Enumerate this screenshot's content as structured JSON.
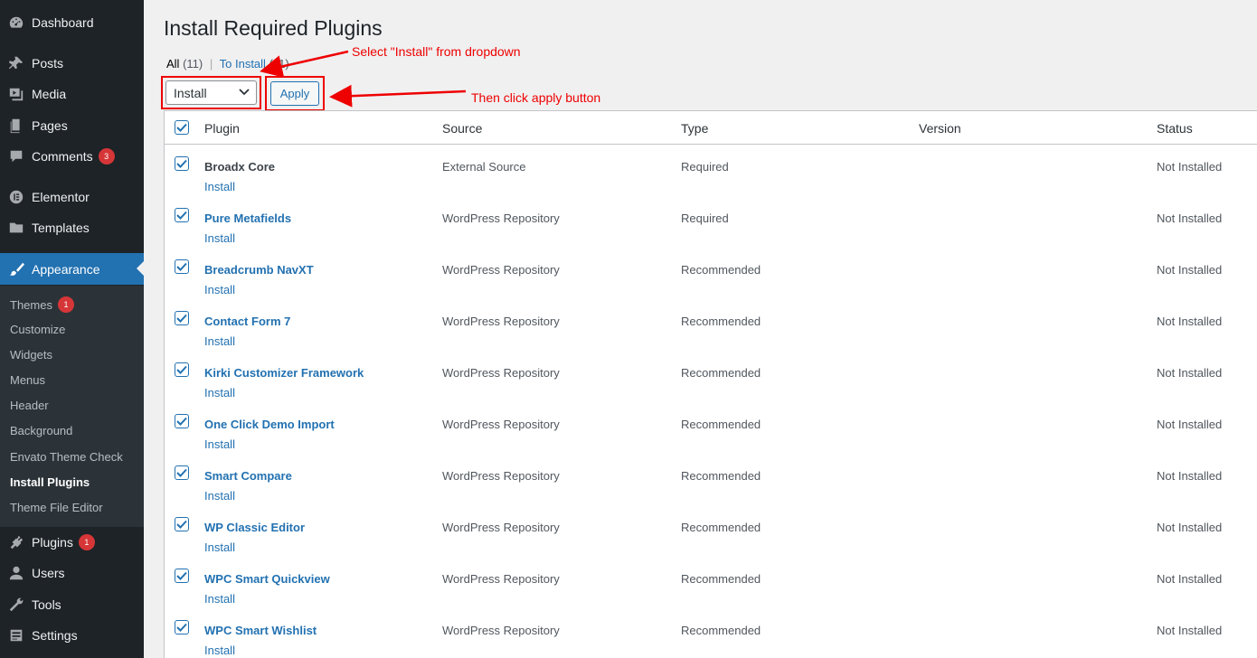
{
  "sidebar": {
    "dashboard": "Dashboard",
    "posts": "Posts",
    "media": "Media",
    "pages": "Pages",
    "comments": "Comments",
    "comments_badge": "3",
    "elementor": "Elementor",
    "templates": "Templates",
    "appearance": "Appearance",
    "plugins": "Plugins",
    "plugins_badge": "1",
    "users": "Users",
    "tools": "Tools",
    "settings": "Settings",
    "submenu": {
      "themes": "Themes",
      "themes_badge": "1",
      "customize": "Customize",
      "widgets": "Widgets",
      "menus": "Menus",
      "header": "Header",
      "background": "Background",
      "envato": "Envato Theme Check",
      "install_plugins": "Install Plugins",
      "theme_file_editor": "Theme File Editor"
    }
  },
  "page": {
    "title": "Install Required Plugins",
    "filter_all": "All",
    "filter_all_count": "(11)",
    "separator": "|",
    "filter_to_install": "To Install",
    "filter_to_install_count": "(11)",
    "bulk_action_selected": "Install",
    "apply_label": "Apply"
  },
  "annotations": {
    "select_hint": "Select \"Install\" from dropdown",
    "apply_hint": "Then click apply button",
    "color": "#ee0000"
  },
  "table": {
    "headers": {
      "plugin": "Plugin",
      "source": "Source",
      "type": "Type",
      "version": "Version",
      "status": "Status"
    },
    "rows": [
      {
        "name": "Broadx Core",
        "action": "Install",
        "source": "External Source",
        "type": "Required",
        "version": "",
        "status": "Not Installed",
        "checked": true
      },
      {
        "name": "Pure Metafields",
        "action": "Install",
        "source": "WordPress Repository",
        "type": "Required",
        "version": "",
        "status": "Not Installed",
        "checked": true
      },
      {
        "name": "Breadcrumb NavXT",
        "action": "Install",
        "source": "WordPress Repository",
        "type": "Recommended",
        "version": "",
        "status": "Not Installed",
        "checked": true
      },
      {
        "name": "Contact Form 7",
        "action": "Install",
        "source": "WordPress Repository",
        "type": "Recommended",
        "version": "",
        "status": "Not Installed",
        "checked": true
      },
      {
        "name": "Kirki Customizer Framework",
        "action": "Install",
        "source": "WordPress Repository",
        "type": "Recommended",
        "version": "",
        "status": "Not Installed",
        "checked": true
      },
      {
        "name": "One Click Demo Import",
        "action": "Install",
        "source": "WordPress Repository",
        "type": "Recommended",
        "version": "",
        "status": "Not Installed",
        "checked": true
      },
      {
        "name": "Smart Compare",
        "action": "Install",
        "source": "WordPress Repository",
        "type": "Recommended",
        "version": "",
        "status": "Not Installed",
        "checked": true
      },
      {
        "name": "WP Classic Editor",
        "action": "Install",
        "source": "WordPress Repository",
        "type": "Recommended",
        "version": "",
        "status": "Not Installed",
        "checked": true
      },
      {
        "name": "WPC Smart Quickview",
        "action": "Install",
        "source": "WordPress Repository",
        "type": "Recommended",
        "version": "",
        "status": "Not Installed",
        "checked": true
      },
      {
        "name": "WPC Smart Wishlist",
        "action": "Install",
        "source": "WordPress Repository",
        "type": "Recommended",
        "version": "",
        "status": "Not Installed",
        "checked": true
      }
    ]
  },
  "colors": {
    "sidebar_bg": "#1d2327",
    "submenu_bg": "#2c3338",
    "accent": "#2271b1",
    "badge": "#d63638"
  }
}
